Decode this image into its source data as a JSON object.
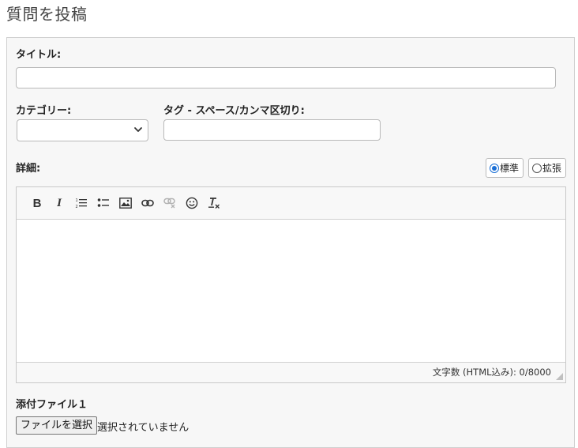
{
  "page": {
    "title": "質問を投稿"
  },
  "form": {
    "title_label": "タイトル:",
    "title_value": "",
    "category_label": "カテゴリー:",
    "category_selected": "",
    "tags_label": "タグ - スペース/カンマ区切り:",
    "tags_value": "",
    "details_label": "詳細:",
    "mode_standard": "標準",
    "mode_extended": "拡張",
    "mode_selected": "標準"
  },
  "editor": {
    "toolbar_icons": [
      "bold-icon",
      "italic-icon",
      "numbered-list-icon",
      "bullet-list-icon",
      "image-icon",
      "link-icon",
      "unlink-icon",
      "emoji-icon",
      "remove-format-icon"
    ],
    "bold_glyph": "B",
    "italic_glyph": "I",
    "content": "",
    "char_count": "文字数 (HTML込み): 0/8000"
  },
  "attachment": {
    "label": "添付ファイル１",
    "choose_button": "ファイルを選択",
    "status": "選択されていません"
  },
  "colors": {
    "accent": "#1a6fd6",
    "panel_bg": "#f7f7f7",
    "border": "#cfcfcf"
  }
}
